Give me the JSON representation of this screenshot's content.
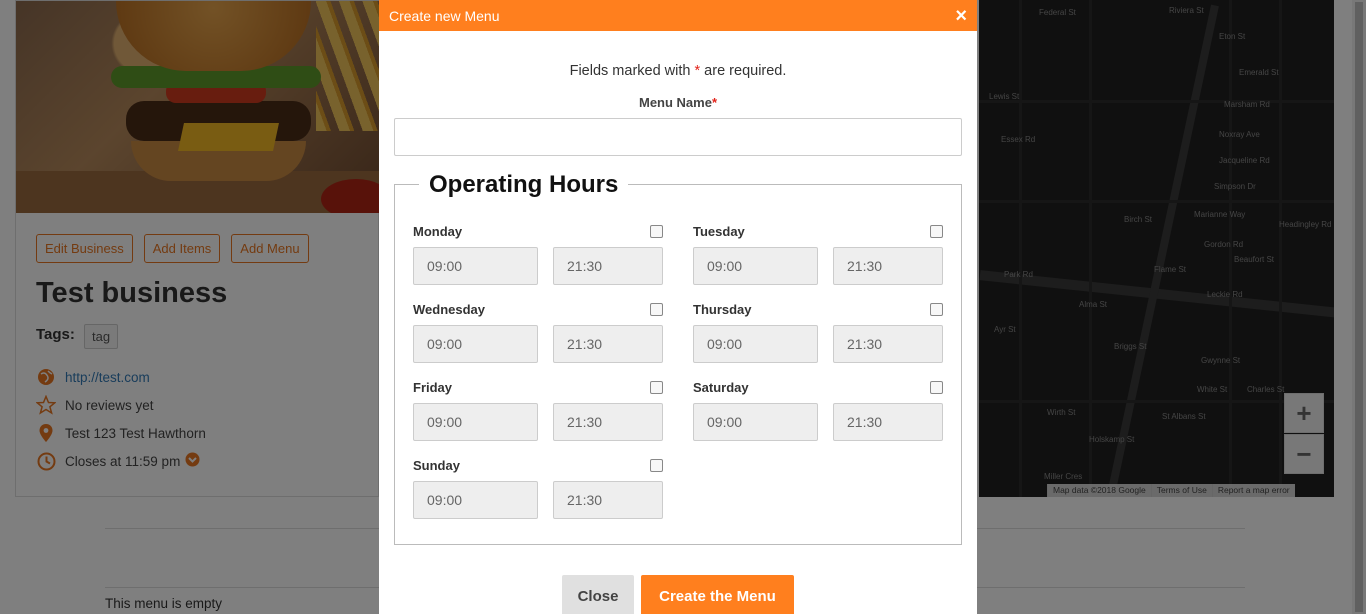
{
  "business": {
    "buttons": [
      "Edit Business",
      "Add Items",
      "Add Menu"
    ],
    "title": "Test business",
    "tags_label": "Tags:",
    "tags": [
      "tag"
    ],
    "website": "http://test.com",
    "reviews": "No reviews yet",
    "address": "Test 123 Test Hawthorn",
    "hours": "Closes at 11:59 pm"
  },
  "menu_section": {
    "empty_text": "This menu is empty"
  },
  "map": {
    "streets": [
      "Federal St",
      "Riviera St",
      "Eton St",
      "Emerald St",
      "Lewis St",
      "Marsham Rd",
      "Essex Rd",
      "Noxray Ave",
      "Jacqueline Rd",
      "Simpson Dr",
      "Birch St",
      "Marianne Way",
      "Gordon Rd",
      "Flame St",
      "Leckie Rd",
      "Park Rd",
      "Briggs St",
      "Gwynne St",
      "White St",
      "St Albans St",
      "Holskamp St",
      "Miller Cres",
      "Charles St",
      "Wirth St",
      "Alma St",
      "Beaufort St",
      "Headingley Rd",
      "Ayr St"
    ],
    "footer": [
      "Map data ©2018 Google",
      "Terms of Use",
      "Report a map error"
    ],
    "zoom_in": "+",
    "zoom_out": "−"
  },
  "modal": {
    "title": "Create new Menu",
    "close_icon": "×",
    "required_note_pre": "Fields marked with ",
    "required_star": "*",
    "required_note_post": " are required.",
    "menu_name_label": "Menu Name",
    "menu_name_value": "",
    "operating_hours_legend": "Operating Hours",
    "days": [
      {
        "name": "Monday",
        "open": "09:00",
        "close": "21:30",
        "checked": false
      },
      {
        "name": "Tuesday",
        "open": "09:00",
        "close": "21:30",
        "checked": false
      },
      {
        "name": "Wednesday",
        "open": "09:00",
        "close": "21:30",
        "checked": false
      },
      {
        "name": "Thursday",
        "open": "09:00",
        "close": "21:30",
        "checked": false
      },
      {
        "name": "Friday",
        "open": "09:00",
        "close": "21:30",
        "checked": false
      },
      {
        "name": "Saturday",
        "open": "09:00",
        "close": "21:30",
        "checked": false
      },
      {
        "name": "Sunday",
        "open": "09:00",
        "close": "21:30",
        "checked": false
      }
    ],
    "close_button": "Close",
    "create_button": "Create the Menu"
  },
  "colors": {
    "accent": "#ff7f1e",
    "link": "#337ab7",
    "required": "#e2231a"
  }
}
